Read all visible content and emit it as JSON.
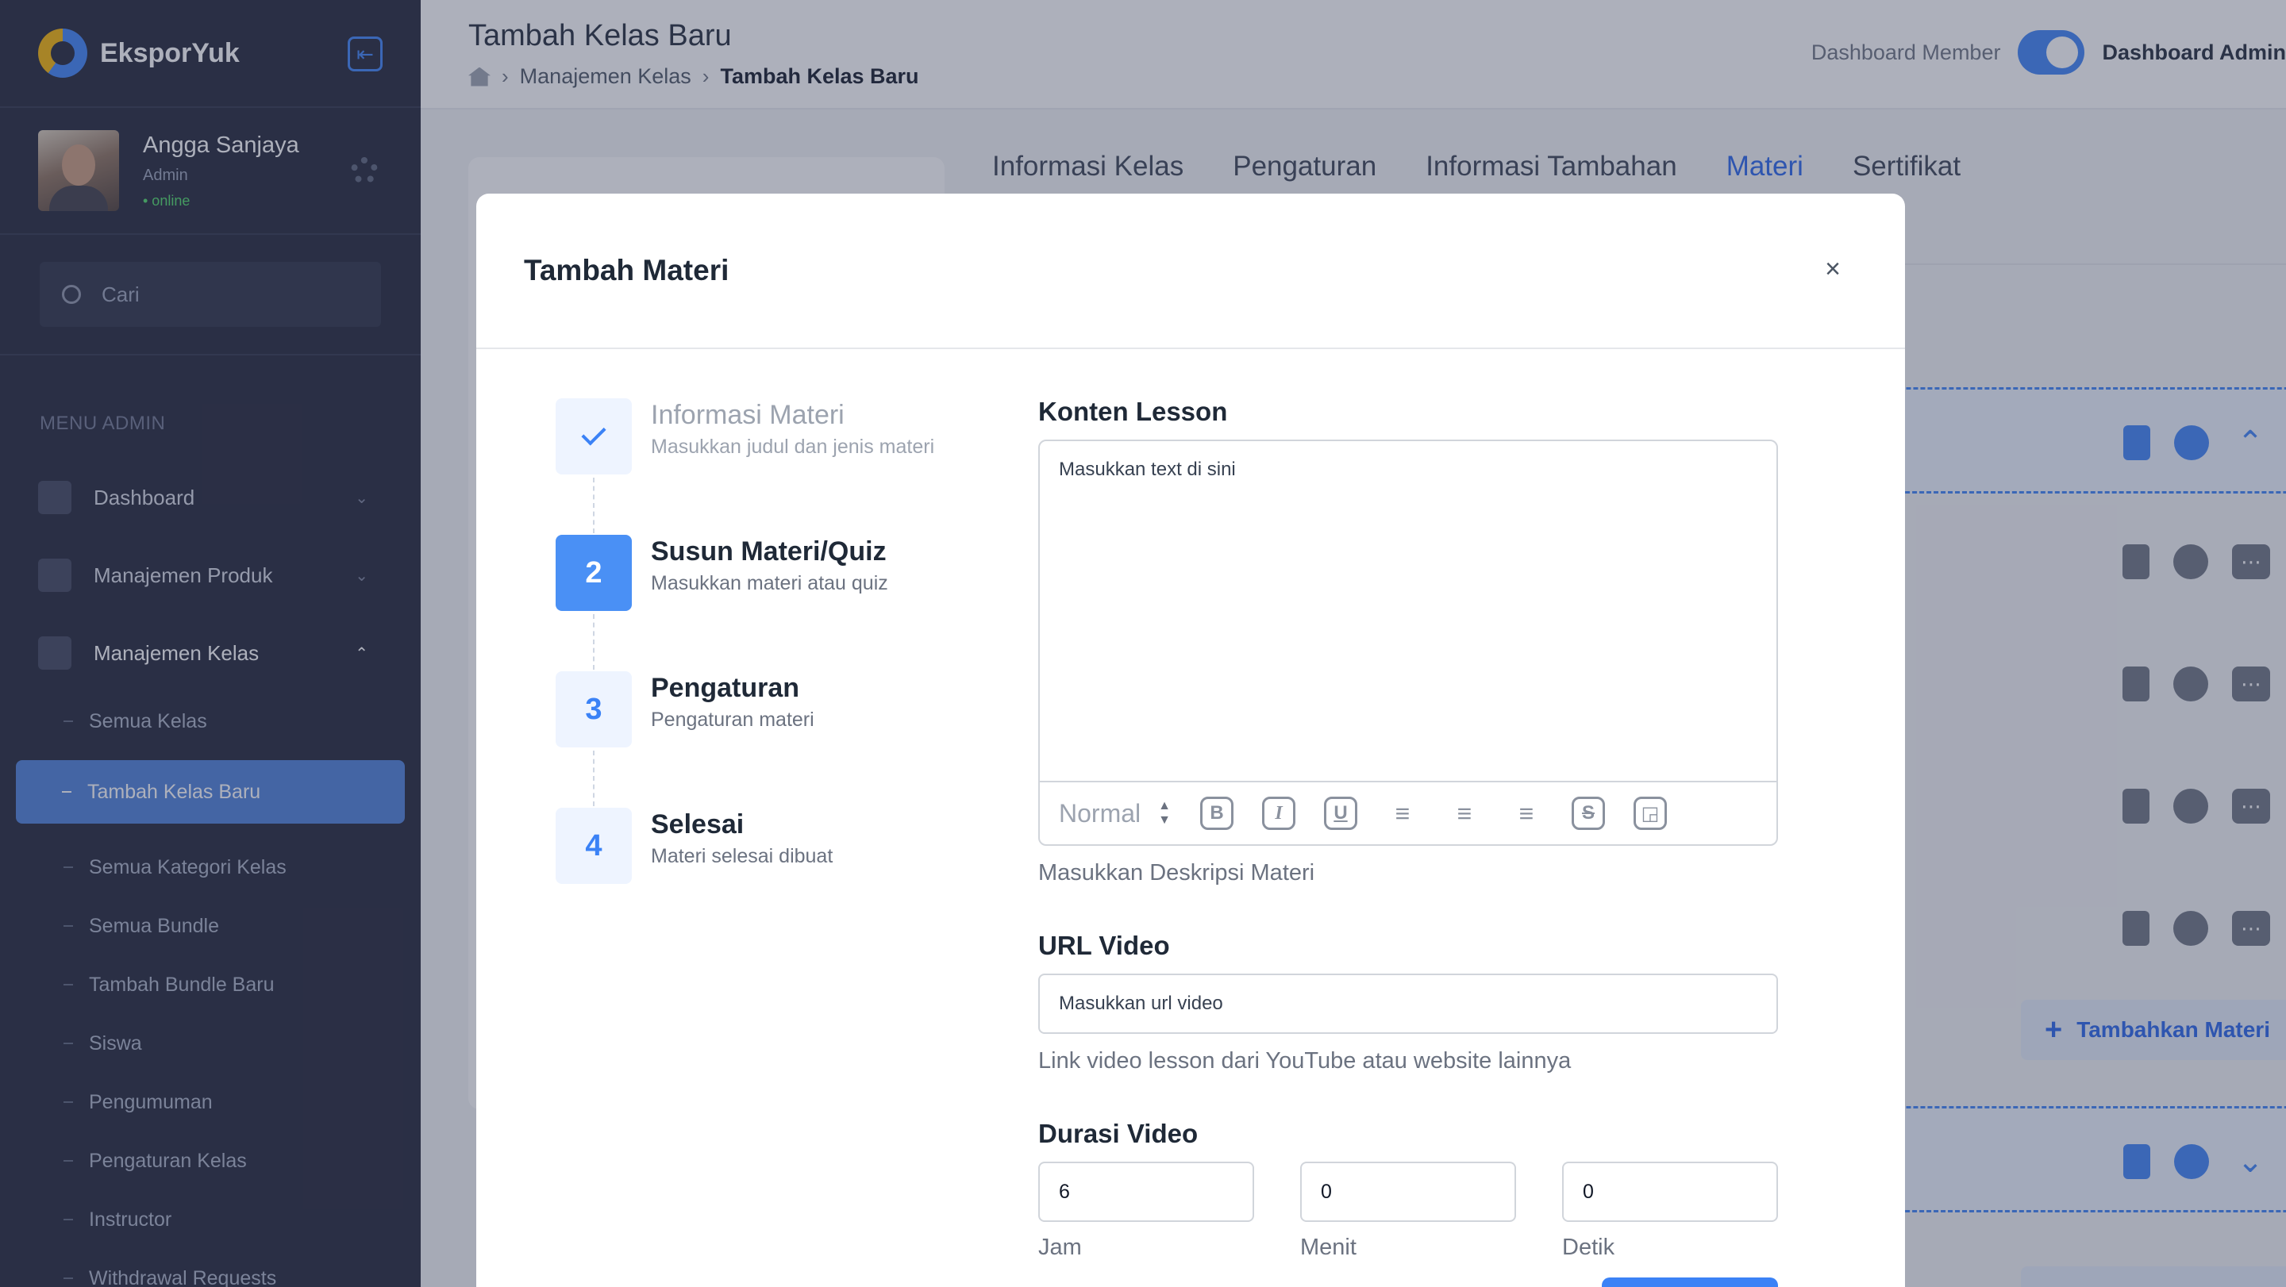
{
  "brand": {
    "name": "EksporYuk"
  },
  "profile": {
    "name": "Angga Sanjaya",
    "role": "Admin",
    "status": "• online"
  },
  "search": {
    "placeholder": "Cari"
  },
  "menu": {
    "title": "MENU ADMIN",
    "items": [
      {
        "label": "Dashboard",
        "chevron": "⌄"
      },
      {
        "label": "Manajemen Produk",
        "chevron": "⌄"
      },
      {
        "label": "Manajemen Kelas",
        "chevron": "⌃"
      }
    ],
    "sub_items": [
      "Semua Kelas",
      "Tambah Kelas Baru",
      "Semua Kategori Kelas",
      "Semua Bundle",
      "Tambah Bundle Baru",
      "Siswa",
      "Pengumuman",
      "Pengaturan Kelas",
      "Instructor",
      "Withdrawal Requests"
    ],
    "active_sub": "Tambah Kelas Baru"
  },
  "header": {
    "title": "Tambah Kelas Baru",
    "breadcrumb": [
      "Manajemen Kelas",
      "Tambah Kelas Baru"
    ],
    "dashboard_member": "Dashboard Member",
    "dashboard_admin": "Dashboard Admin"
  },
  "tabs": [
    "Informasi Kelas",
    "Pengaturan",
    "Informasi Tambahan",
    "Materi",
    "Sertifikat"
  ],
  "active_tab": "Materi",
  "background_actions": {
    "add_materi": "Tambahkan Materi"
  },
  "modal": {
    "title": "Tambah Materi",
    "close": "×",
    "steps": [
      {
        "number": "✓",
        "title": "Informasi Materi",
        "subtitle": "Masukkan judul dan jenis materi",
        "state": "done"
      },
      {
        "number": "2",
        "title": "Susun Materi/Quiz",
        "subtitle": "Masukkan materi atau quiz",
        "state": "active"
      },
      {
        "number": "3",
        "title": "Pengaturan",
        "subtitle": "Pengaturan materi",
        "state": "pending"
      },
      {
        "number": "4",
        "title": "Selesai",
        "subtitle": "Materi selesai dibuat",
        "state": "pending"
      }
    ],
    "form": {
      "content_label": "Konten Lesson",
      "content_placeholder": "Masukkan text di sini",
      "toolbar_format": "Normal",
      "content_help": "Masukkan Deskripsi Materi",
      "url_label": "URL Video",
      "url_placeholder": "Masukkan url video",
      "url_help": "Link video lesson dari YouTube atau website lainnya",
      "duration_label": "Durasi Video",
      "hours": "6",
      "minutes": "0",
      "seconds": "0",
      "hours_label": "Jam",
      "minutes_label": "Menit",
      "seconds_label": "Detik"
    }
  },
  "colors": {
    "accent": "#3b82f6",
    "sidebar": "#1e2235",
    "active_menu": "#4a7fd8",
    "online": "#4cd964"
  }
}
